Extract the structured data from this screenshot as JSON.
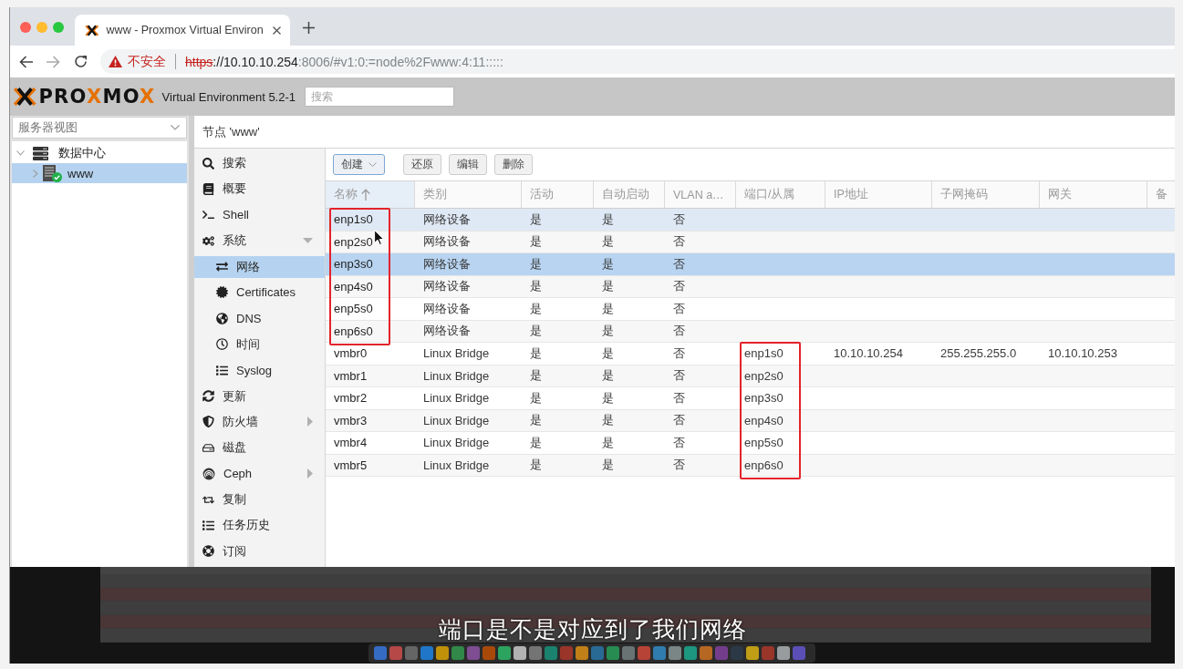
{
  "browser": {
    "tabs": [
      {
        "title": "www - Proxmox Virtual Environ",
        "selected": true
      }
    ],
    "address_bar": {
      "security_label": "不安全",
      "url_scheme": "https",
      "url_host": "://10.10.10.254",
      "url_rest": ":8006/#v1:0:=node%2Fwww:4:11:::::"
    }
  },
  "app_header": {
    "logo_parts": [
      "PRO",
      "X",
      "MO",
      "X"
    ],
    "version": "Virtual Environment 5.2-1",
    "search": {
      "placeholder": "搜索"
    }
  },
  "sidebar": {
    "view_selector": "服务器视图",
    "tree": [
      {
        "label": "数据中心",
        "selected": false,
        "expanded": true,
        "children": [
          {
            "label": "www",
            "selected": true,
            "expanded": false,
            "online": true
          }
        ]
      }
    ]
  },
  "node_panel": {
    "title": "节点 'www'",
    "menu": [
      {
        "label": "搜索",
        "selected": false
      },
      {
        "label": "概要",
        "selected": false
      },
      {
        "label": "Shell",
        "selected": false
      },
      {
        "label": "系统",
        "selected": false,
        "expanded": true,
        "children": [
          {
            "label": "网络",
            "selected": true
          },
          {
            "label": "Certificates",
            "selected": false
          },
          {
            "label": "DNS",
            "selected": false
          },
          {
            "label": "时间",
            "selected": false
          },
          {
            "label": "Syslog",
            "selected": false
          }
        ]
      },
      {
        "label": "更新",
        "selected": false
      },
      {
        "label": "防火墙",
        "selected": false,
        "expanded": false
      },
      {
        "label": "磁盘",
        "selected": false
      },
      {
        "label": "Ceph",
        "selected": false,
        "expanded": false
      },
      {
        "label": "复制",
        "selected": false
      },
      {
        "label": "任务历史",
        "selected": false
      },
      {
        "label": "订阅",
        "selected": false
      }
    ],
    "toolbar": [
      {
        "label": "创建",
        "kind": "menu"
      },
      {
        "label": "还原",
        "kind": "plain"
      },
      {
        "label": "编辑",
        "kind": "plain"
      },
      {
        "label": "删除",
        "kind": "plain"
      }
    ],
    "table": {
      "columns": [
        {
          "label": "名称",
          "sorted": true
        },
        {
          "label": "类别",
          "sorted": false
        },
        {
          "label": "活动",
          "sorted": false
        },
        {
          "label": "自动启动",
          "sorted": false
        },
        {
          "label": "VLAN a…",
          "sorted": false
        },
        {
          "label": "端口/从属",
          "sorted": false
        },
        {
          "label": "IP地址",
          "sorted": false
        },
        {
          "label": "子网掩码",
          "sorted": false
        },
        {
          "label": "网关",
          "sorted": false
        },
        {
          "label": "备",
          "sorted": false
        }
      ],
      "rows": [
        {
          "selected": false,
          "hovered": true,
          "cells": [
            {
              "text": "enp1s0",
              "framed": true
            },
            {
              "text": "网络设备",
              "framed": false
            },
            {
              "text": "是",
              "framed": false
            },
            {
              "text": "是",
              "framed": false
            },
            {
              "text": "否",
              "framed": false
            }
          ]
        },
        {
          "selected": false,
          "hovered": false,
          "cells": [
            {
              "text": "enp2s0",
              "framed": true
            },
            {
              "text": "网络设备",
              "framed": false
            },
            {
              "text": "是",
              "framed": false
            },
            {
              "text": "是",
              "framed": false
            },
            {
              "text": "否",
              "framed": false
            }
          ]
        },
        {
          "selected": true,
          "hovered": false,
          "cells": [
            {
              "text": "enp3s0",
              "framed": true
            },
            {
              "text": "网络设备",
              "framed": false
            },
            {
              "text": "是",
              "framed": false
            },
            {
              "text": "是",
              "framed": false
            },
            {
              "text": "否",
              "framed": false
            }
          ]
        },
        {
          "selected": false,
          "hovered": false,
          "cells": [
            {
              "text": "enp4s0",
              "framed": true
            },
            {
              "text": "网络设备",
              "framed": false
            },
            {
              "text": "是",
              "framed": false
            },
            {
              "text": "是",
              "framed": false
            },
            {
              "text": "否",
              "framed": false
            }
          ]
        },
        {
          "selected": false,
          "hovered": false,
          "cells": [
            {
              "text": "enp5s0",
              "framed": true
            },
            {
              "text": "网络设备",
              "framed": false
            },
            {
              "text": "是",
              "framed": false
            },
            {
              "text": "是",
              "framed": false
            },
            {
              "text": "否",
              "framed": false
            }
          ]
        },
        {
          "selected": false,
          "hovered": false,
          "cells": [
            {
              "text": "enp6s0",
              "framed": true
            },
            {
              "text": "网络设备",
              "framed": false
            },
            {
              "text": "是",
              "framed": false
            },
            {
              "text": "是",
              "framed": false
            },
            {
              "text": "否",
              "framed": false
            }
          ]
        },
        {
          "selected": false,
          "hovered": false,
          "cells": [
            {
              "text": "vmbr0",
              "framed": false
            },
            {
              "text": "Linux Bridge",
              "framed": false
            },
            {
              "text": "是",
              "framed": false
            },
            {
              "text": "是",
              "framed": false
            },
            {
              "text": "否",
              "framed": false
            },
            {
              "text": "enp1s0",
              "framed": true
            },
            {
              "text": "10.10.10.254",
              "framed": false
            },
            {
              "text": "255.255.255.0",
              "framed": false
            },
            {
              "text": "10.10.10.253",
              "framed": false
            }
          ]
        },
        {
          "selected": false,
          "hovered": false,
          "cells": [
            {
              "text": "vmbr1",
              "framed": false
            },
            {
              "text": "Linux Bridge",
              "framed": false
            },
            {
              "text": "是",
              "framed": false
            },
            {
              "text": "是",
              "framed": false
            },
            {
              "text": "否",
              "framed": false
            },
            {
              "text": "enp2s0",
              "framed": true
            }
          ]
        },
        {
          "selected": false,
          "hovered": false,
          "cells": [
            {
              "text": "vmbr2",
              "framed": false
            },
            {
              "text": "Linux Bridge",
              "framed": false
            },
            {
              "text": "是",
              "framed": false
            },
            {
              "text": "是",
              "framed": false
            },
            {
              "text": "否",
              "framed": false
            },
            {
              "text": "enp3s0",
              "framed": true
            }
          ]
        },
        {
          "selected": false,
          "hovered": false,
          "cells": [
            {
              "text": "vmbr3",
              "framed": false
            },
            {
              "text": "Linux Bridge",
              "framed": false
            },
            {
              "text": "是",
              "framed": false
            },
            {
              "text": "是",
              "framed": false
            },
            {
              "text": "否",
              "framed": false
            },
            {
              "text": "enp4s0",
              "framed": true
            }
          ]
        },
        {
          "selected": false,
          "hovered": false,
          "cells": [
            {
              "text": "vmbr4",
              "framed": false
            },
            {
              "text": "Linux Bridge",
              "framed": false
            },
            {
              "text": "是",
              "framed": false
            },
            {
              "text": "是",
              "framed": false
            },
            {
              "text": "否",
              "framed": false
            },
            {
              "text": "enp5s0",
              "framed": true
            }
          ]
        },
        {
          "selected": false,
          "hovered": false,
          "cells": [
            {
              "text": "vmbr5",
              "framed": false
            },
            {
              "text": "Linux Bridge",
              "framed": false
            },
            {
              "text": "是",
              "framed": false
            },
            {
              "text": "是",
              "framed": false
            },
            {
              "text": "否",
              "framed": false
            },
            {
              "text": "enp6s0",
              "framed": true
            }
          ]
        }
      ]
    }
  },
  "video_overlay": {
    "subtitle": "端口是不是对应到了我们网络"
  }
}
